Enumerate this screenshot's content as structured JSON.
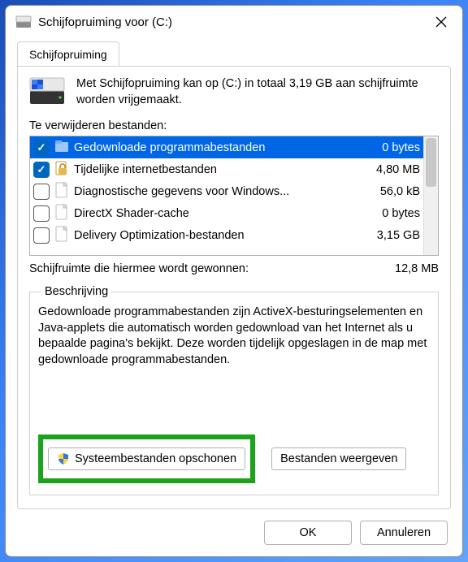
{
  "window": {
    "title": "Schijfopruiming voor  (C:)"
  },
  "tab": {
    "label": "Schijfopruiming"
  },
  "intro": "Met Schijfopruiming kan op  (C:) in totaal 3,19 GB aan schijfruimte worden vrijgemaakt.",
  "files_label": "Te verwijderen bestanden:",
  "files": [
    {
      "name": "Gedownloade programmabestanden",
      "size": "0 bytes",
      "checked": true,
      "selected": true,
      "icon": "folder"
    },
    {
      "name": "Tijdelijke internetbestanden",
      "size": "4,80 MB",
      "checked": true,
      "selected": false,
      "icon": "lock"
    },
    {
      "name": "Diagnostische gegevens voor Windows...",
      "size": "56,0 kB",
      "checked": false,
      "selected": false,
      "icon": "file"
    },
    {
      "name": "DirectX Shader-cache",
      "size": "0 bytes",
      "checked": false,
      "selected": false,
      "icon": "file"
    },
    {
      "name": "Delivery Optimization-bestanden",
      "size": "3,15 GB",
      "checked": false,
      "selected": false,
      "icon": "file"
    }
  ],
  "gained": {
    "label": "Schijfruimte die hiermee wordt gewonnen:",
    "value": "12,8 MB"
  },
  "description": {
    "legend": "Beschrijving",
    "text": "Gedownloade programmabestanden zijn ActiveX-besturingselementen en Java-applets die automatisch worden gedownload van het Internet als u bepaalde pagina's bekijkt. Deze worden tijdelijk opgeslagen in de map met gedownloade programmabestanden."
  },
  "buttons": {
    "cleanup_system": "Systeembestanden opschonen",
    "view_files": "Bestanden weergeven",
    "ok": "OK",
    "cancel": "Annuleren"
  }
}
